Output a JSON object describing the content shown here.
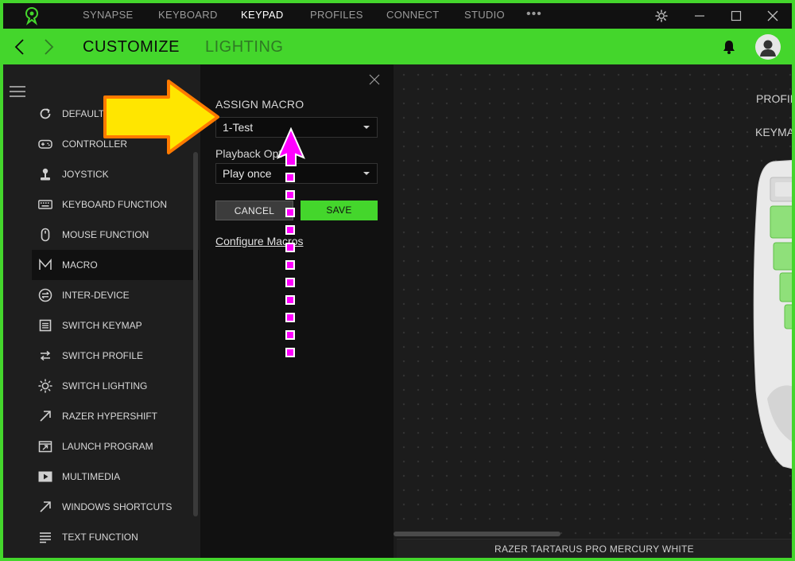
{
  "topnav": {
    "tabs": [
      {
        "label": "SYNAPSE"
      },
      {
        "label": "KEYBOARD"
      },
      {
        "label": "KEYPAD"
      },
      {
        "label": "PROFILES"
      },
      {
        "label": "CONNECT"
      },
      {
        "label": "STUDIO"
      }
    ],
    "active_tab": "KEYPAD",
    "more_label": "•••"
  },
  "subheader": {
    "tabs": [
      "CUSTOMIZE",
      "LIGHTING"
    ],
    "active_tab": "CUSTOMIZE"
  },
  "sidebar": {
    "items": [
      {
        "label": "DEFAULT",
        "icon": "refresh-icon"
      },
      {
        "label": "CONTROLLER",
        "icon": "gamepad-icon"
      },
      {
        "label": "JOYSTICK",
        "icon": "joystick-icon"
      },
      {
        "label": "KEYBOARD FUNCTION",
        "icon": "keyboard-icon"
      },
      {
        "label": "MOUSE FUNCTION",
        "icon": "mouse-icon"
      },
      {
        "label": "MACRO",
        "icon": "macro-icon"
      },
      {
        "label": "INTER-DEVICE",
        "icon": "inter-device-icon"
      },
      {
        "label": "SWITCH KEYMAP",
        "icon": "keymap-icon"
      },
      {
        "label": "SWITCH PROFILE",
        "icon": "swap-icon"
      },
      {
        "label": "SWITCH LIGHTING",
        "icon": "sun-icon"
      },
      {
        "label": "RAZER HYPERSHIFT",
        "icon": "arrow-up-right-icon"
      },
      {
        "label": "LAUNCH PROGRAM",
        "icon": "launch-icon"
      },
      {
        "label": "MULTIMEDIA",
        "icon": "play-icon"
      },
      {
        "label": "WINDOWS SHORTCUTS",
        "icon": "shortcut-icon"
      },
      {
        "label": "TEXT FUNCTION",
        "icon": "text-icon"
      }
    ],
    "active_item": "MACRO"
  },
  "panel": {
    "title": "ASSIGN MACRO",
    "macro_value": "1-Test",
    "playback_label": "Playback Options",
    "playback_label_visible": "Playback Opt",
    "playback_value": "Play once",
    "cancel_label": "CANCEL",
    "save_label": "SAVE",
    "configure_link": "Configure Macros"
  },
  "canvas": {
    "label_1": "PROFIL",
    "label_2": "KEYMA",
    "device_name": "RAZER TARTARUS PRO MERCURY WHITE"
  },
  "colors": {
    "accent": "#44d62c",
    "annotation_arrow": "#ffe600",
    "annotation_path": "#ff00ff"
  }
}
